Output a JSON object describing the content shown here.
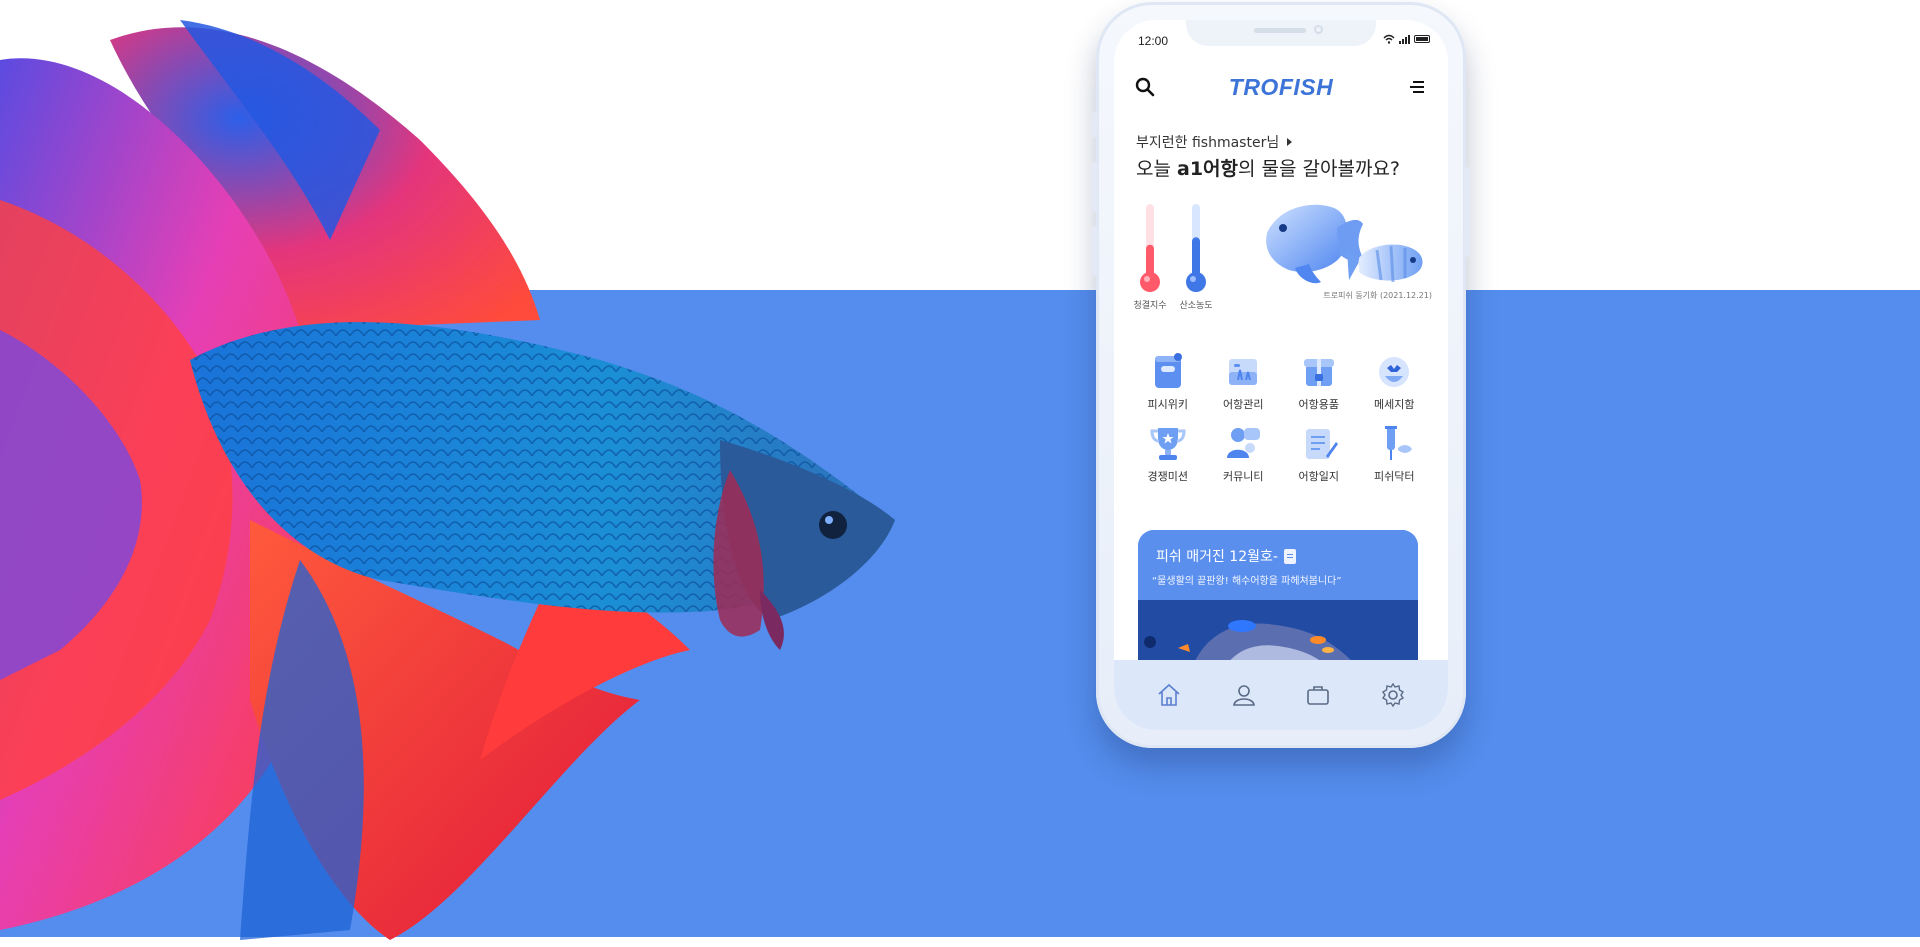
{
  "phone": {
    "status": {
      "time": "12:00"
    },
    "header": {
      "logo": "TROFISH"
    },
    "greeting": {
      "name_line": "부지런한 fishmaster님",
      "question_prefix": "오늘 ",
      "tank_name": "a1어항",
      "question_suffix": "의 물을 갈아볼까요?"
    },
    "gauges": [
      {
        "label": "청결지수",
        "level": 0.45,
        "color": "#ff5a6a"
      },
      {
        "label": "산소농도",
        "level": 0.55,
        "color": "#3f78e6"
      }
    ],
    "sync_text": "트로피쉬 동기화 (2021.12.21)",
    "menu": [
      {
        "label": "피시위키",
        "icon": "book-icon"
      },
      {
        "label": "어항관리",
        "icon": "aquarium-icon"
      },
      {
        "label": "어항용품",
        "icon": "gift-box-icon"
      },
      {
        "label": "메세지함",
        "icon": "message-icon"
      },
      {
        "label": "경쟁미션",
        "icon": "trophy-icon"
      },
      {
        "label": "커뮤니티",
        "icon": "community-icon"
      },
      {
        "label": "어항일지",
        "icon": "journal-icon"
      },
      {
        "label": "피쉬닥터",
        "icon": "syringe-icon"
      }
    ],
    "magazine": {
      "title": "피쉬 매거진 12월호-",
      "subtitle": "“물생활의 끝판왕! 해수어항을 파헤쳐봅니다”"
    },
    "tabs": [
      "home-icon",
      "profile-icon",
      "bag-icon",
      "settings-icon"
    ]
  },
  "colors": {
    "band": "#548ded",
    "accent": "#3d74d8",
    "tabbar": "#dce8fa"
  }
}
